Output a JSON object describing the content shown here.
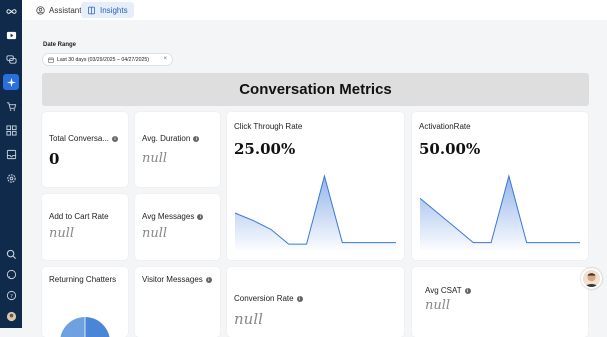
{
  "tabs": [
    {
      "label": "Assistant",
      "icon": "user-circle-icon",
      "active": false
    },
    {
      "label": "Insights",
      "icon": "book-icon",
      "active": true
    }
  ],
  "sidebar": {
    "items": [
      {
        "icon": "infinity-logo-icon"
      },
      {
        "icon": "play-icon"
      },
      {
        "icon": "chat-bubbles-icon"
      },
      {
        "icon": "sparkle-icon",
        "active": true
      },
      {
        "icon": "cart-icon"
      },
      {
        "icon": "grid-icon"
      },
      {
        "icon": "inbox-icon"
      },
      {
        "icon": "settings-icon"
      },
      {
        "icon": "search-icon"
      },
      {
        "icon": "message-icon"
      },
      {
        "icon": "help-icon"
      },
      {
        "icon": "user-avatar-icon"
      }
    ]
  },
  "filters": {
    "date_label": "Date Range",
    "date_value": "Last 30 days (03/29/2025 – 04/27/2025)",
    "clear": "×"
  },
  "banner": {
    "title": "Conversation Metrics"
  },
  "cards": {
    "total_conversations": {
      "label": "Total Conversa...",
      "value": "0"
    },
    "avg_duration": {
      "label": "Avg. Duration",
      "value": "null"
    },
    "click_through_rate": {
      "label": "Click Through Rate",
      "value": "25.00%"
    },
    "activation_rate": {
      "label": "ActivationRate",
      "value": "50.00%"
    },
    "add_to_cart_rate": {
      "label": "Add to Cart Rate",
      "value": "null"
    },
    "avg_messages": {
      "label": "Avg Messages",
      "value": "null"
    },
    "returning_chatters": {
      "label": "Returning Chatters"
    },
    "visitor_messages": {
      "label": "Visitor Messages"
    },
    "conversion_rate": {
      "label": "Conversion Rate",
      "value": "null"
    },
    "avg_csat": {
      "label": "Avg CSAT",
      "value": "null"
    }
  },
  "colors": {
    "accent": "#2a6fdb",
    "sidebar": "#0f2a4a",
    "chart_line": "#3b78d8"
  },
  "chart_data": [
    {
      "type": "area",
      "series": [
        {
          "values": [
            0.5,
            0.4,
            0.28,
            0.08,
            0.08,
            1.0,
            0.1,
            0.1,
            0.1,
            0.1
          ]
        }
      ],
      "ylim": [
        0,
        1
      ]
    },
    {
      "type": "area",
      "series": [
        {
          "values": [
            0.7,
            0.5,
            0.3,
            0.1,
            0.1,
            1.0,
            0.1,
            0.1,
            0.1,
            0.1
          ]
        }
      ],
      "ylim": [
        0,
        1
      ]
    }
  ]
}
